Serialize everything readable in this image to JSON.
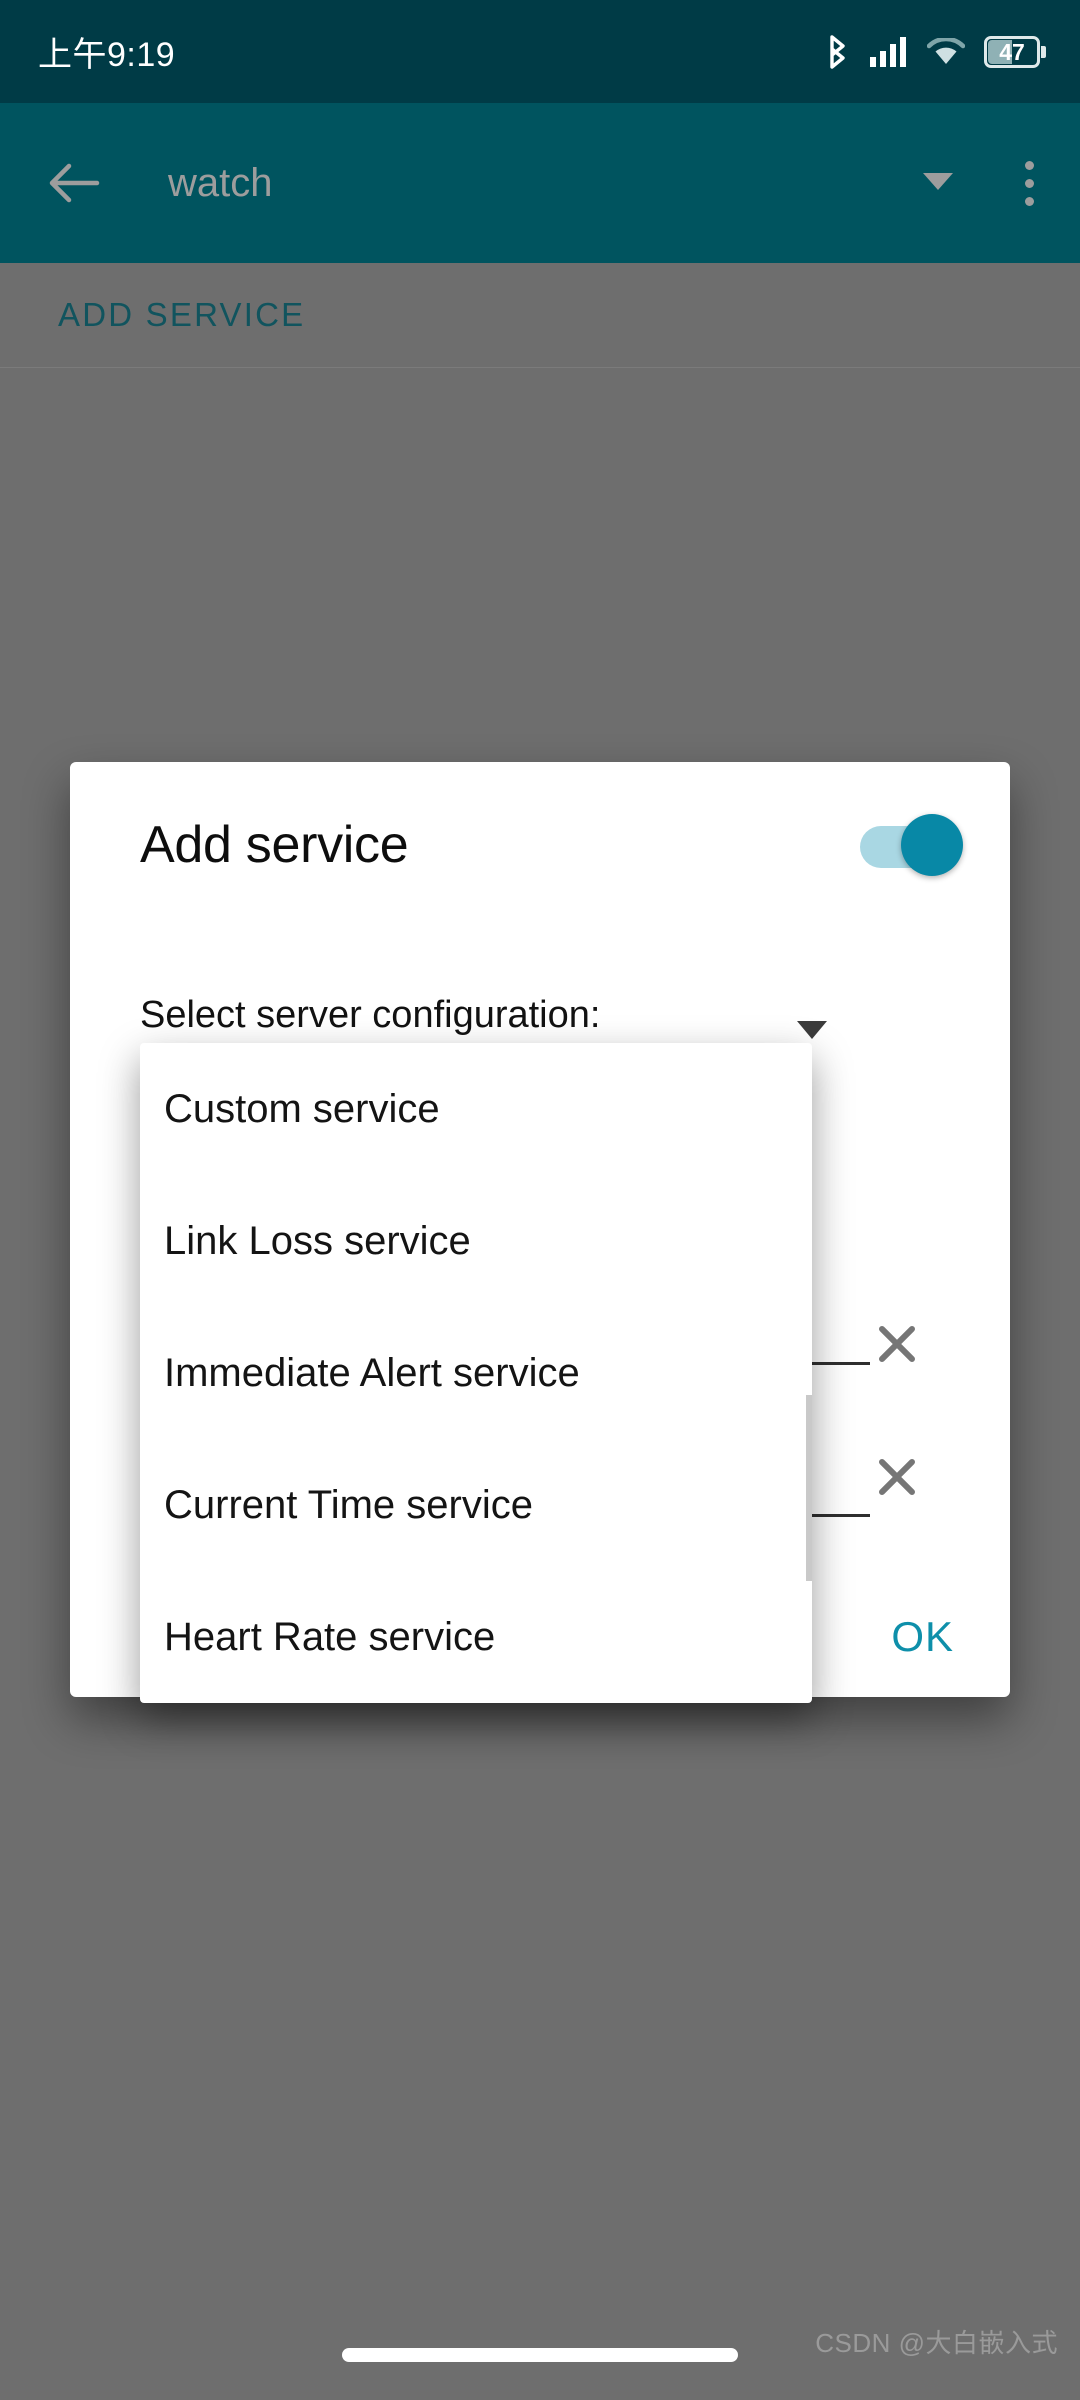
{
  "status_bar": {
    "time": "上午9:19",
    "battery_level": "47",
    "icons": [
      "bluetooth-icon",
      "cellular-signal-icon",
      "wifi-icon",
      "battery-icon"
    ],
    "background": "#003b46",
    "text_color": "#ffffff"
  },
  "toolbar": {
    "title": "watch",
    "back_icon": "arrow-left-icon",
    "spinner_icon": "caret-down-icon",
    "overflow_icon": "more-vertical-icon",
    "background": "#00545f",
    "title_color": "#9d9d9d"
  },
  "tabs": {
    "items": [
      {
        "label": "ADD SERVICE",
        "selected": true
      }
    ],
    "color": "#11545e"
  },
  "dialog": {
    "title": "Add service",
    "toggle": {
      "name": "enable-service-toggle",
      "state": "on",
      "track_color": "#a9d7e3",
      "thumb_color": "#0888a6"
    },
    "select_label": "Select server configuration:",
    "spinner": {
      "selected_value": "",
      "caret": "caret-down-icon"
    },
    "fields": [
      {
        "value": "",
        "clear_icon": "close-x-icon"
      },
      {
        "value": "",
        "clear_icon": "close-x-icon"
      }
    ],
    "ok_label": "OK",
    "ok_color": "#0e8faa"
  },
  "dropdown_popup": {
    "items": [
      {
        "label": "Custom service"
      },
      {
        "label": "Link Loss service"
      },
      {
        "label": "Immediate Alert service"
      },
      {
        "label": "Current Time service"
      },
      {
        "label": "Heart Rate service"
      }
    ],
    "scrollbar_visible": true
  },
  "bottom": {
    "nav_pill": true,
    "watermark": "CSDN @大白嵌入式"
  }
}
